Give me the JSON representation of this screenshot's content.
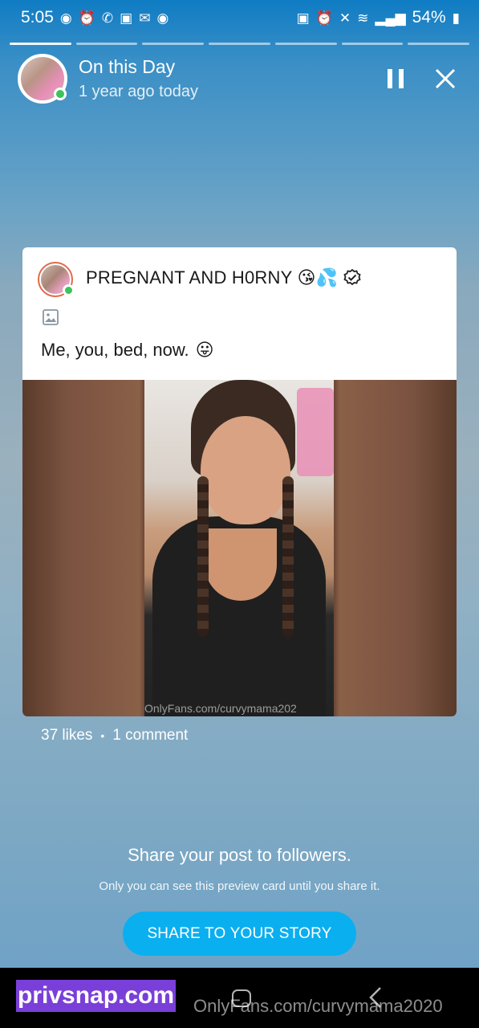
{
  "status_bar": {
    "time": "5:05",
    "battery": "54%",
    "left_icons": [
      "record-icon",
      "alarm-icon",
      "wifi-call-icon",
      "gallery-icon",
      "mail-icon",
      "record-icon"
    ],
    "right_icons": [
      "lock-icon",
      "alarm-icon",
      "mute-icon",
      "wifi-icon",
      "signal-icon",
      "battery-icon"
    ]
  },
  "story": {
    "segments": 7,
    "active_segment": 1,
    "title": "On this Day",
    "subtitle": "1 year ago today"
  },
  "post": {
    "author": "PREGNANT AND H0RNY",
    "author_emojis": "😘💦",
    "caption": "Me, you, bed, now.",
    "caption_emoji": "😛",
    "photo_watermark": "OnlyFans.com/curvymama202",
    "likes": "37 likes",
    "comments": "1 comment"
  },
  "share": {
    "title": "Share your post to followers.",
    "subtitle": "Only you can see this preview card until you share it.",
    "button": "SHARE TO YOUR STORY"
  },
  "overlay": {
    "brand": "privsnap.com",
    "watermark": "OnlyFans.com/curvymama2020"
  },
  "colors": {
    "accent_button": "#0aaff0",
    "online": "#3ec25b",
    "brand_bg": "#7a3fd8"
  }
}
